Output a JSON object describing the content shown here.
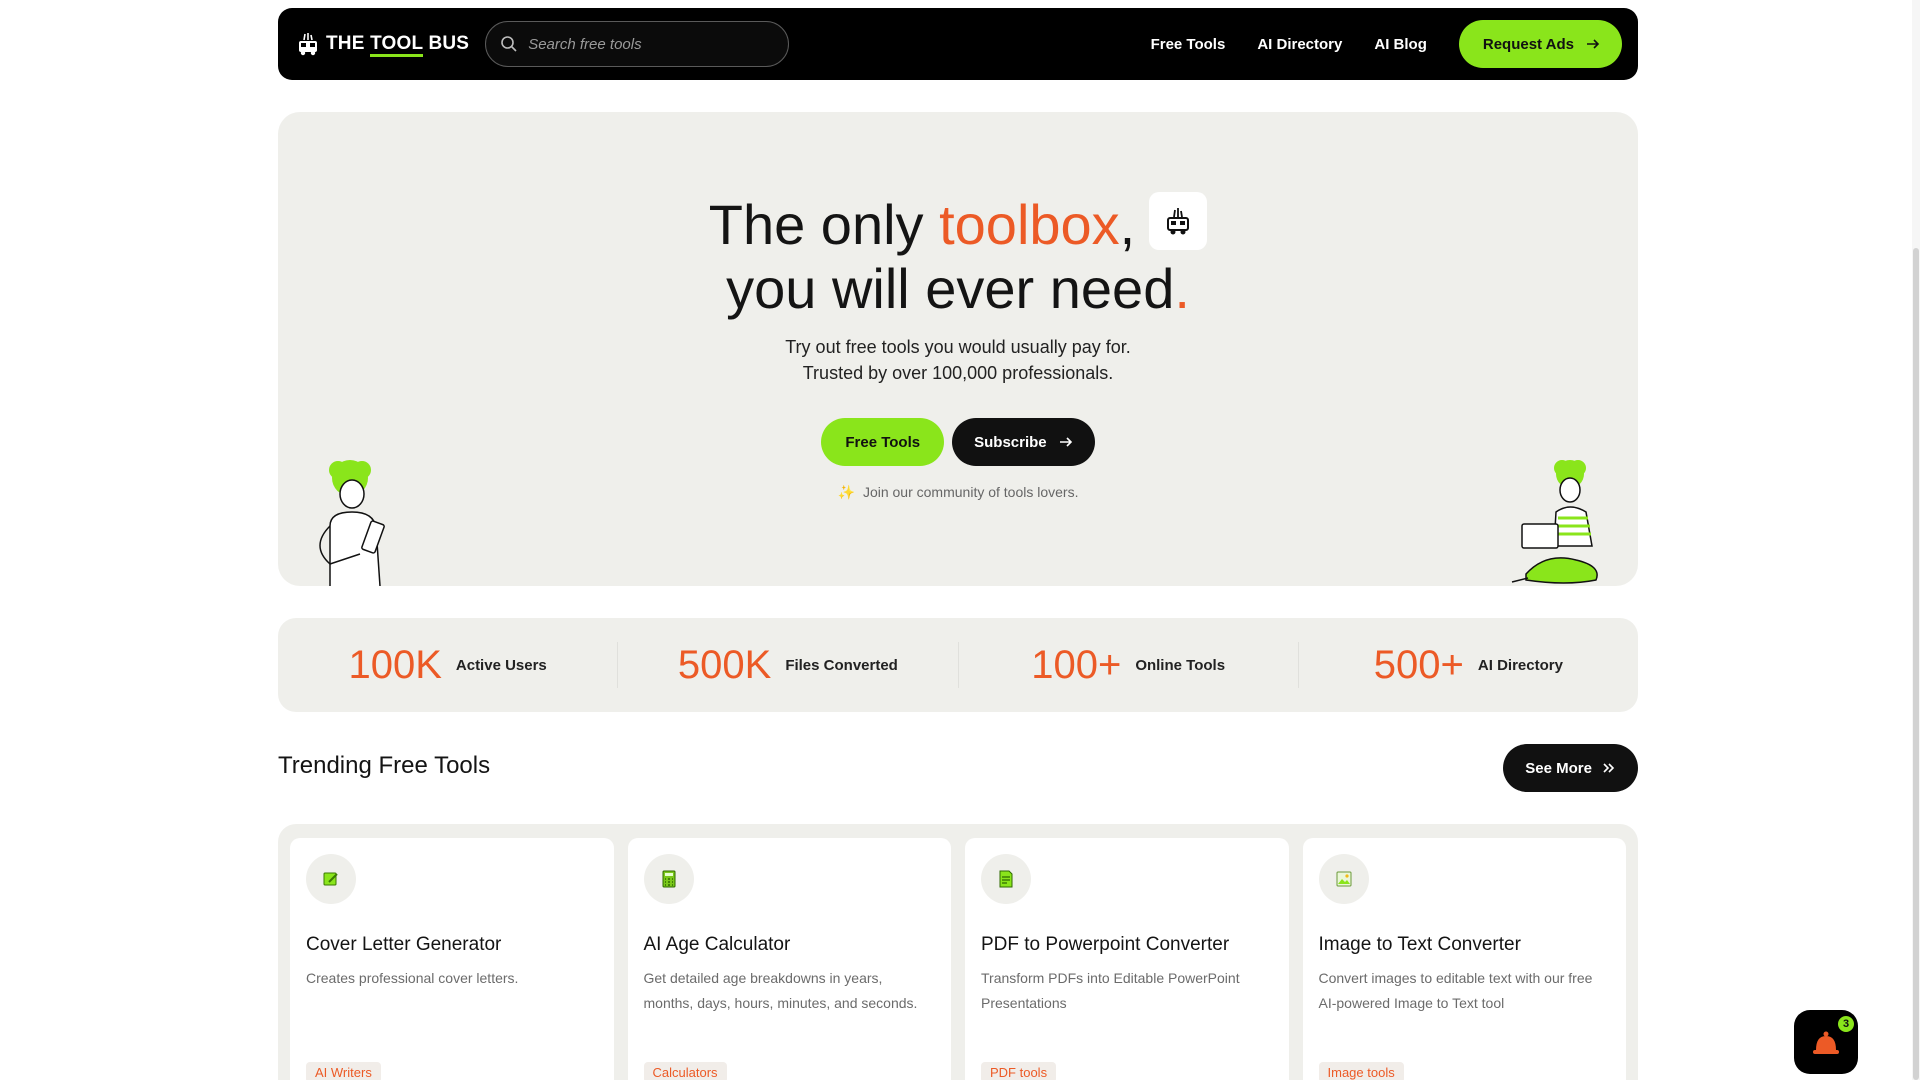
{
  "navbar": {
    "brand_prefix": "THE ",
    "brand_highlight": "TOOL",
    "brand_suffix": " BUS",
    "search_placeholder": "Search free tools",
    "links": [
      {
        "label": "Free Tools"
      },
      {
        "label": "AI Directory"
      },
      {
        "label": "AI Blog"
      }
    ],
    "cta_label": "Request Ads"
  },
  "hero": {
    "title_part1": "The only ",
    "title_accent": "toolbox",
    "title_comma": ",",
    "title_line2": "you will ever need",
    "title_dot": ".",
    "subtitle_line1": "Try out free tools you would usually pay for.",
    "subtitle_line2": "Trusted by over 100,000 professionals.",
    "primary_button": "Free Tools",
    "secondary_button": "Subscribe",
    "community_text": "Join our community of tools lovers."
  },
  "stats": [
    {
      "value": "100K",
      "label": "Active Users"
    },
    {
      "value": "500K",
      "label": "Files Converted"
    },
    {
      "value": "100+",
      "label": "Online Tools"
    },
    {
      "value": "500+",
      "label": "AI Directory"
    }
  ],
  "trending": {
    "title": "Trending Free Tools",
    "see_more": "See More",
    "cards": [
      {
        "title": "Cover Letter Generator",
        "description": "Creates professional cover letters.",
        "tag": "AI Writers",
        "icon": "cover-letter-icon"
      },
      {
        "title": "AI Age Calculator",
        "description": "Get detailed age breakdowns in years, months, days, hours, minutes, and seconds.",
        "tag": "Calculators",
        "icon": "calculator-icon"
      },
      {
        "title": "PDF to Powerpoint Converter",
        "description": "Transform PDFs into Editable PowerPoint Presentations",
        "tag": "PDF tools",
        "icon": "document-icon"
      },
      {
        "title": "Image to Text Converter",
        "description": "Convert images to editable text with our free AI-powered Image to Text tool",
        "tag": "Image tools",
        "icon": "image-icon"
      }
    ]
  },
  "chat_widget": {
    "badge_count": "3"
  },
  "colors": {
    "accent_green": "#8ae51b",
    "accent_orange": "#ec5a26",
    "dark": "#111111",
    "panel": "#efefeb"
  }
}
